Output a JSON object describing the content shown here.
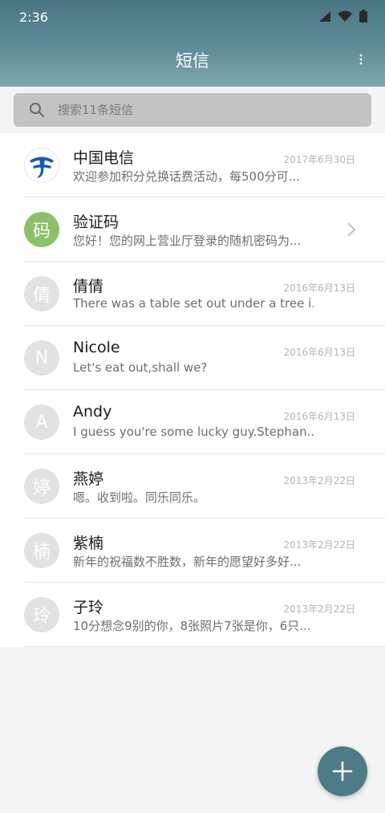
{
  "status_bar": {
    "time": "2:36",
    "icons": [
      "signal-icon",
      "wifi-icon",
      "battery-icon"
    ]
  },
  "header": {
    "title": "短信",
    "menu_icon": "more-vert-icon"
  },
  "search": {
    "placeholder": "搜索11条短信",
    "icon": "search-icon"
  },
  "conversations": [
    {
      "name": "中国电信",
      "preview": "欢迎参加积分兑换话费活动，每500分可...",
      "date": "2017年6月30日",
      "avatar": "",
      "avatar_type": "logo"
    },
    {
      "name": "验证码",
      "preview": "您好！您的网上营业厅登录的随机密码为...",
      "date": "",
      "avatar": "码",
      "avatar_type": "green"
    },
    {
      "name": "倩倩",
      "preview": "There was a table set out under a tree i...",
      "date": "2016年6月13日",
      "avatar": "倩",
      "avatar_type": "gray"
    },
    {
      "name": "Nicole",
      "preview": "Let's eat out,shall we?",
      "date": "2016年6月13日",
      "avatar": "N",
      "avatar_type": "gray"
    },
    {
      "name": "Andy",
      "preview": "I guess you're some lucky guy.Stephan...",
      "date": "2016年6月13日",
      "avatar": "A",
      "avatar_type": "gray"
    },
    {
      "name": "燕婷",
      "preview": "嗯。收到啦。同乐同乐。",
      "date": "2013年2月22日",
      "avatar": "婷",
      "avatar_type": "gray"
    },
    {
      "name": "紫楠",
      "preview": "新年的祝福数不胜数，新年的愿望好多好...",
      "date": "2013年2月22日",
      "avatar": "楠",
      "avatar_type": "gray"
    },
    {
      "name": "子玲",
      "preview": "10分想念9别的你，8张照片7张是你，6只...",
      "date": "2013年2月22日",
      "avatar": "玲",
      "avatar_type": "gray"
    }
  ],
  "fab": {
    "icon": "plus-icon"
  },
  "colors": {
    "header_top": "#4a7585",
    "header_bottom": "#7ea6ad",
    "fab": "#4e7b88",
    "verify_avatar": "#8dc06b",
    "default_avatar": "#e2e2e2",
    "telecom_blue": "#1a5ca8"
  }
}
